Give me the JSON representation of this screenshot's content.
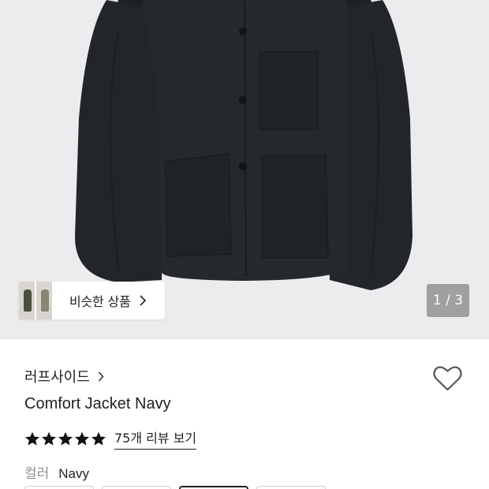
{
  "product_image": {
    "alt_subject": "jacket-image",
    "counter": "1 / 3"
  },
  "similar": {
    "label": "비슷한 상품",
    "thumb_colors": [
      "#4b4f3e",
      "#8a8472"
    ]
  },
  "brand": {
    "name": "러프사이드"
  },
  "product": {
    "title": "Comfort Jacket Navy",
    "rating": 5,
    "review_link": "75개 리뷰 보기"
  },
  "options": {
    "color_label": "컬러",
    "color_value": "Navy",
    "swatch_count": 4,
    "selected_index": 2
  },
  "colors": {
    "jacket": "#23262b",
    "background": "#ececee",
    "star": "#111111",
    "muted_text": "#8e8e8e"
  }
}
